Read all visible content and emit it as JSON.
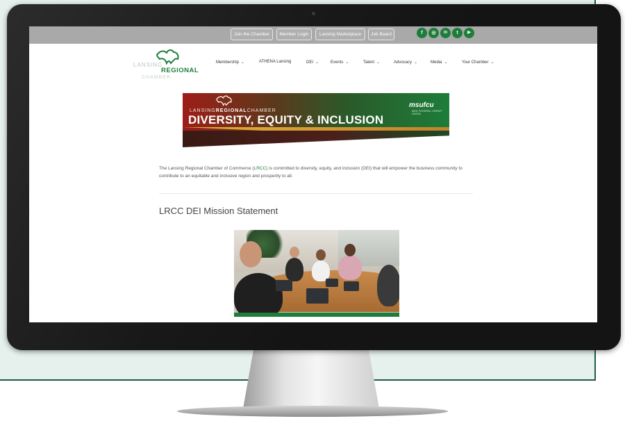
{
  "topbar": {
    "buttons": [
      "Join the Chamber",
      "Member Login",
      "Lansing Marketplace",
      "Job Board"
    ],
    "social_icons": [
      {
        "icon": "facebook-icon",
        "glyph": "f"
      },
      {
        "icon": "instagram-icon",
        "glyph": "◎"
      },
      {
        "icon": "linkedin-icon",
        "glyph": "in"
      },
      {
        "icon": "twitter-icon",
        "glyph": "t"
      },
      {
        "icon": "youtube-icon",
        "glyph": "▶"
      }
    ]
  },
  "logo": {
    "line1": "LANSING",
    "line2": "REGIONAL",
    "line3": "CHAMBER"
  },
  "nav": {
    "items": [
      {
        "label": "Membership",
        "chevron": "⌄"
      },
      {
        "label": "ATHENA Lansing",
        "chevron": ""
      },
      {
        "label": "DEI",
        "chevron": "⌄"
      },
      {
        "label": "Events",
        "chevron": "⌄"
      },
      {
        "label": "Talent",
        "chevron": "⌄"
      },
      {
        "label": "Advocacy",
        "chevron": "⌄"
      },
      {
        "label": "Media",
        "chevron": "⌄"
      },
      {
        "label": "Your Chamber",
        "chevron": "⌄"
      }
    ]
  },
  "banner": {
    "org_pre": "LANSING",
    "org_bold": "REGIONAL",
    "org_post": "CHAMBER",
    "title": "DIVERSITY, EQUITY & INCLUSION",
    "sponsor": "msufcu",
    "sponsor_tagline": "MSU FEDERAL CREDIT UNION"
  },
  "content": {
    "intro_before": "The Lansing Regional Chamber of Commerce (",
    "intro_link": "LRCC",
    "intro_after": ") is committed to diversity, equity, and inclusion (DEI) that will empower the business community to contribute to an equitable and inclusive region and prosperity to all.",
    "heading": "LRCC DEI Mission Statement"
  },
  "colors": {
    "brand_green": "#1d7d3a",
    "topbar_gray": "#a9a9a9",
    "frame_teal": "#1f5a49"
  }
}
